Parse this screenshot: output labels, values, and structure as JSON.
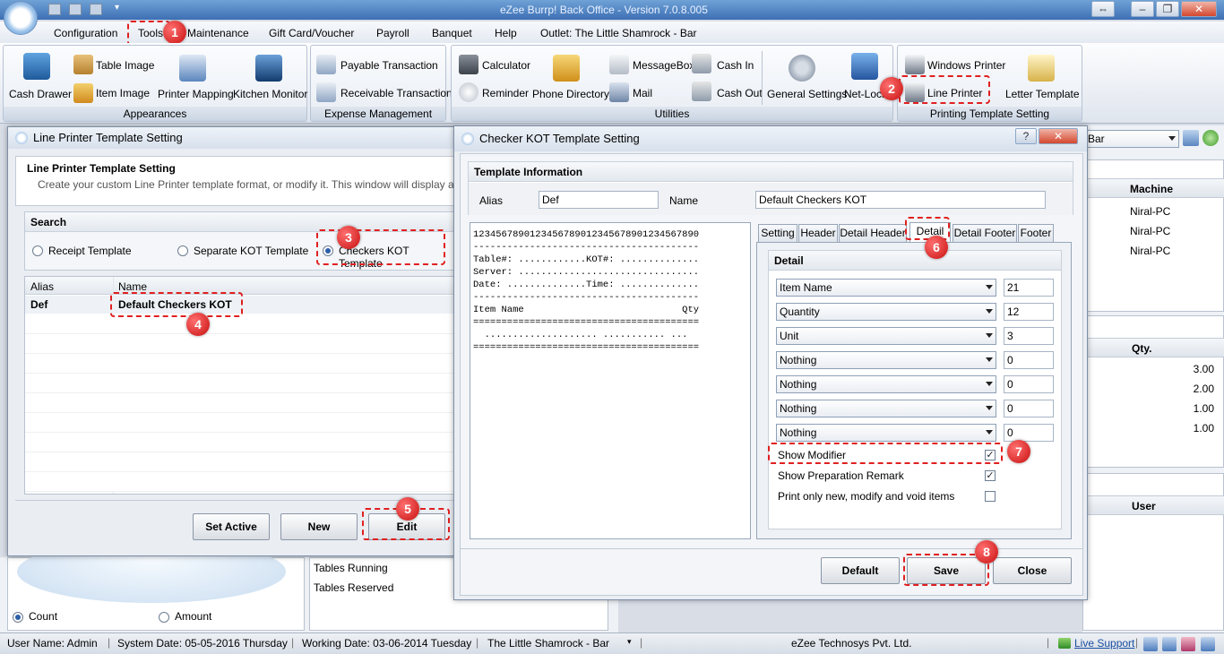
{
  "app": {
    "title": "eZee Burrp! Back Office - Version 7.0.8.005"
  },
  "menu": {
    "items": [
      "Configuration",
      "Tools",
      "Maintenance",
      "Gift Card/Voucher",
      "Payroll",
      "Banquet",
      "Help",
      "Outlet: The Little Shamrock - Bar"
    ]
  },
  "ribbon": {
    "appearance": {
      "label": "Appearances",
      "items": [
        "Cash Drawer",
        "Table Image",
        "Item Image",
        "Printer Mapping",
        "Kitchen Monitor"
      ]
    },
    "expense": {
      "label": "Expense Management",
      "items": [
        "Payable Transaction",
        "Receivable Transaction"
      ]
    },
    "utilities": {
      "label": "Utilities",
      "items": [
        "Calculator",
        "Reminder",
        "Phone Directory",
        "MessageBox",
        "Mail",
        "Cash In",
        "Cash Out",
        "General Settings",
        "Net-Lock"
      ]
    },
    "printing": {
      "label": "Printing Template Setting",
      "items": [
        "Windows Printer",
        "Line Printer",
        "Letter Template"
      ]
    }
  },
  "badges": [
    "1",
    "2",
    "3",
    "4",
    "5",
    "6",
    "7",
    "8"
  ],
  "lpts": {
    "window_title": "Line Printer Template Setting",
    "header_title": "Line Printer Template Setting",
    "header_desc": "Create your custom Line Printer template format, or modify it. This window will display all the tem",
    "search_title": "Search",
    "radios": [
      "Receipt Template",
      "Separate KOT Template",
      "Checkers KOT Template"
    ],
    "columns": [
      "Alias",
      "Name"
    ],
    "rows": [
      {
        "alias": "Def",
        "name": "Default Checkers KOT"
      }
    ],
    "buttons": {
      "set_active": "Set Active",
      "new": "New",
      "edit": "Edit"
    }
  },
  "kot": {
    "window_title": "Checker KOT Template Setting",
    "info_title": "Template Information",
    "alias_label": "Alias",
    "alias_value": "Def",
    "name_label": "Name",
    "name_value": "Default Checkers KOT",
    "preview": "1234567890123456789012345678901234567890\n----------------------------------------\nTable#: ............KOT#: ..............\nServer: ................................\nDate: ..............Time: ..............\n----------------------------------------\nItem Name                            Qty\n========================================\n  .................... ........... ...\n========================================",
    "tabs": [
      "Setting",
      "Header",
      "Detail Header",
      "Detail",
      "Detail Footer",
      "Footer"
    ],
    "detail_title": "Detail",
    "fields": [
      {
        "sel": "Item Name",
        "val": "21"
      },
      {
        "sel": "Quantity",
        "val": "12"
      },
      {
        "sel": "Unit",
        "val": "3"
      },
      {
        "sel": "Nothing",
        "val": "0"
      },
      {
        "sel": "Nothing",
        "val": "0"
      },
      {
        "sel": "Nothing",
        "val": "0"
      },
      {
        "sel": "Nothing",
        "val": "0"
      }
    ],
    "checks": [
      {
        "label": "Show Modifier",
        "checked": true
      },
      {
        "label": "Show Preparation Remark",
        "checked": true
      },
      {
        "label": "Print only new, modify and void items",
        "checked": false
      }
    ],
    "buttons": {
      "default": "Default",
      "save": "Save",
      "close": "Close"
    }
  },
  "background": {
    "right_select": "Bar",
    "machine_header": "Machine",
    "machines": [
      "Niral-PC",
      "Niral-PC",
      "Niral-PC"
    ],
    "qty_header": "Qty.",
    "qtys": [
      "3.00",
      "2.00",
      "1.00",
      "1.00"
    ],
    "user_header": "User",
    "tables": [
      "Tables Running",
      "Tables Reserved"
    ],
    "count_label": "Count",
    "amount_label": "Amount"
  },
  "status": {
    "user": "User Name:  Admin",
    "sysdate": "System Date:  05-05-2016 Thursday",
    "workdate": "Working Date:  03-06-2014 Tuesday",
    "outlet": "The Little Shamrock - Bar",
    "company": "eZee Technosys Pvt. Ltd.",
    "support": "Live Support"
  }
}
